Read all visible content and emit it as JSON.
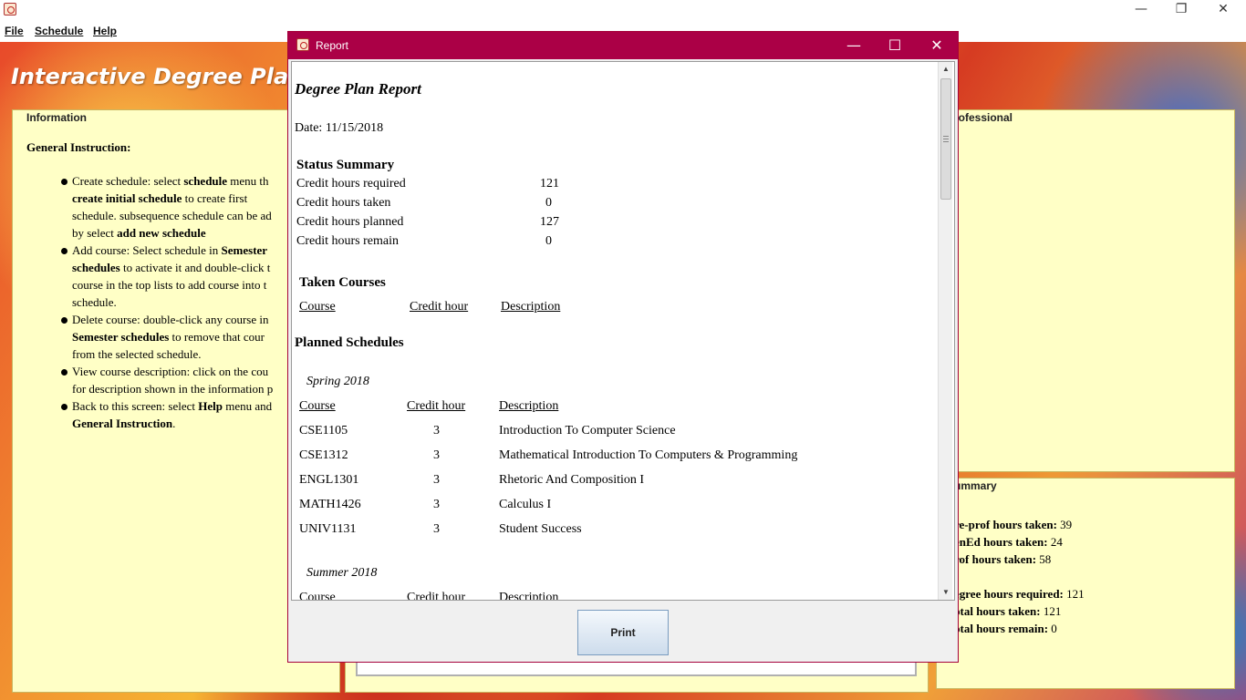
{
  "window": {
    "app_title": "Interactive Degree Planne",
    "controls": {
      "minimize": "—",
      "restore": "❐",
      "close": "✕"
    }
  },
  "menu": [
    "File",
    "Schedule",
    "Help"
  ],
  "info_panel": {
    "title": "Information",
    "heading": "General Instruction:",
    "bullets": [
      [
        "Create schedule: select ",
        "schedule",
        " menu th",
        " create initial schedule",
        " to create first",
        " schedule. subsequence schedule can be ad",
        " by select ",
        "add new schedule"
      ],
      [
        "Add course: Select schedule in ",
        "Semester",
        " schedules",
        " to activate it and double-click t",
        " course in the top lists to add course into t",
        " schedule."
      ],
      [
        "Delete course: double-click any course in",
        " Semester schedules",
        " to remove that cour",
        " from the selected schedule."
      ],
      [
        "View course description: click on the cou",
        " for description shown in the information p"
      ],
      [
        "Back to this screen: select ",
        "Help",
        " menu and",
        " General Instruction",
        "."
      ]
    ]
  },
  "right_panels": {
    "top_title": "rofessional",
    "summary_title": "ummary",
    "summary_lines": [
      {
        "label": "re-prof hours taken:",
        "value": "39"
      },
      {
        "label": "enEd hours taken:",
        "value": "24"
      },
      {
        "label": "rof hours taken:",
        "value": "58"
      },
      {
        "label": "",
        "value": ""
      },
      {
        "label": "egree hours required:",
        "value": "121"
      },
      {
        "label": "otal hours taken:",
        "value": "121"
      },
      {
        "label": "otal hours remain:",
        "value": "0"
      }
    ]
  },
  "dialog": {
    "title": "Report",
    "controls": {
      "minimize": "—",
      "maximize": "☐",
      "close": "✕"
    },
    "print_label": "Print",
    "report": {
      "heading": "Degree Plan Report",
      "date": "Date: 11/15/2018",
      "status_heading": "Status Summary",
      "status": [
        {
          "label": "Credit hours required",
          "value": "121"
        },
        {
          "label": "Credit hours taken",
          "value": "0"
        },
        {
          "label": "Credit hours planned",
          "value": "127"
        },
        {
          "label": "Credit hours remain",
          "value": "0"
        }
      ],
      "taken_heading": "Taken Courses",
      "columns": {
        "course": "Course",
        "credit": "Credit hour",
        "desc": "Description"
      },
      "planned_heading": "Planned Schedules",
      "semesters": [
        {
          "name": "Spring 2018",
          "courses": [
            {
              "course": "CSE1105",
              "credit": "3",
              "desc": "Introduction To Computer Science"
            },
            {
              "course": "CSE1312",
              "credit": "3",
              "desc": "Mathematical Introduction To Computers & Programming"
            },
            {
              "course": "ENGL1301",
              "credit": "3",
              "desc": "Rhetoric And Composition I"
            },
            {
              "course": "MATH1426",
              "credit": "3",
              "desc": "Calculus I"
            },
            {
              "course": "UNIV1131",
              "credit": "3",
              "desc": "Student Success"
            }
          ]
        },
        {
          "name": "Summer 2018",
          "courses": []
        }
      ]
    }
  }
}
